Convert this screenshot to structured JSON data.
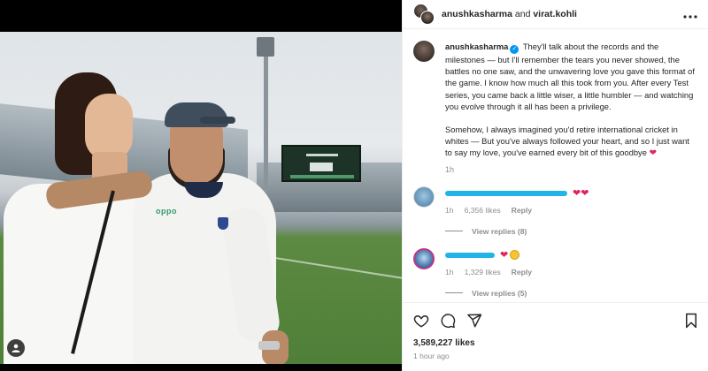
{
  "header": {
    "user1": "anushkasharma",
    "conjunction": "and",
    "user2": "virat.kohli",
    "more_icon": "more-horizontal-icon"
  },
  "photo": {
    "jersey_text": "oppo"
  },
  "caption": {
    "username": "anushkasharma",
    "paragraph1": "They'll talk about the records and the milestones — but I'll remember the tears you never showed, the battles no one saw, and the unwavering love you gave this format of the game. I know how much all this took from you. After every Test series, you came back a little wiser, a little humbler — and watching you evolve through it all has been a privilege.",
    "paragraph2": "Somehow, I always imagined you'd retire international cricket in whites — But you've always followed your heart, and so I just want to say my love, you've earned every bit of this goodbye",
    "heart": "❤",
    "age": "1h"
  },
  "comments": [
    {
      "emoji": "❤❤",
      "age": "1h",
      "likes": "6,356 likes",
      "reply": "Reply",
      "view_replies": "View replies (8)"
    },
    {
      "emoji": "❤",
      "age": "1h",
      "likes": "1,329 likes",
      "reply": "Reply",
      "view_replies": "View replies (5)"
    }
  ],
  "footer": {
    "likes": "3,589,227 likes",
    "time": "1 hour ago"
  },
  "colors": {
    "accent": "#0095f6",
    "heart": "#e0245e",
    "muted": "#8e8e8e"
  }
}
